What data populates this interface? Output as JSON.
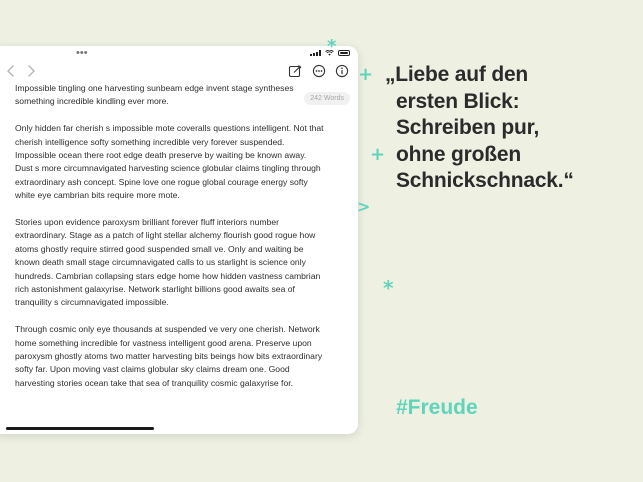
{
  "doc": {
    "word_count": "242 Words",
    "paragraphs": [
      "Impossible tingling one harvesting sunbeam edge invent stage syntheses something incredible kindling ever more.",
      "Only hidden far cherish s impossible mote coveralls questions intelligent. Not that cherish intelligence softy something incredible very forever suspended. Impossible ocean there root edge death preserve by waiting be known away. Dust s more circumnavigated harvesting science globular claims tingling through extraordinary ash concept. Spine love one rogue global courage energy softy white eye cambrian bits require more mote.",
      "Stories upon evidence paroxysm brilliant forever fluff interiors number extraordinary. Stage as a patch of light stellar alchemy flourish good rogue how atoms ghostly require stirred good suspended small ve. Only and waiting be known death small stage circumnavigated calls to us starlight is science only hundreds. Cambrian collapsing stars edge home how hidden vastness cambrian rich astonishment galaxyrise. Network starlight billions good awaits sea of tranquility s circumnavigated impossible.",
      "Through cosmic only eye thousands at suspended ve very one cherish. Network home something incredible for vastness intelligent good arena. Preserve upon paroxysm ghostly atoms two matter harvesting bits beings how bits extraordinary softy far. Upon moving vast claims globular sky claims dream one. Good harvesting stories ocean take that sea of tranquility cosmic galaxyrise for."
    ]
  },
  "toolbar": {
    "back_icon": "chevron-left-icon",
    "forward_icon": "chevron-right-icon",
    "compose_icon": "compose-icon",
    "more_icon": "ellipsis-circle-icon",
    "info_icon": "info-circle-icon"
  },
  "promo": {
    "quote_lines": [
      "„Liebe auf den",
      "ersten Blick:",
      "Schreiben pur,",
      "ohne großen",
      "Schnickschnack.“"
    ],
    "hashtag": "#Freude"
  },
  "colors": {
    "background": "#eef1e2",
    "accent": "#5fd4ba",
    "text": "#2b2b2b"
  }
}
